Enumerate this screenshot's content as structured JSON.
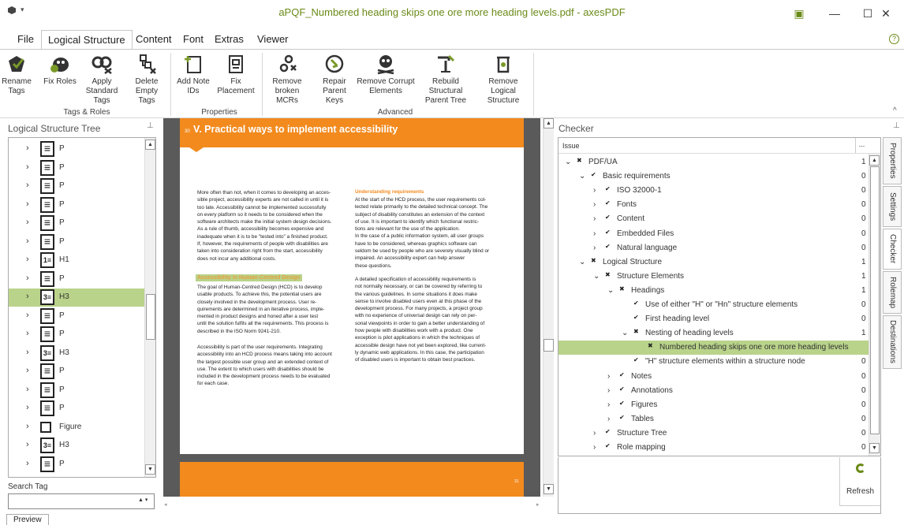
{
  "window": {
    "title": "aPQF_Numbered heading skips one ore more heading levels.pdf - axesPDF"
  },
  "menu": [
    "File",
    "Logical Structure",
    "Content",
    "Font",
    "Extras",
    "Viewer"
  ],
  "ribbon": {
    "buttons": [
      {
        "label1": "Rename",
        "label2": "Tags"
      },
      {
        "label1": "Fix Roles",
        "label2": ""
      },
      {
        "label1": "Apply",
        "label2": "Standard Tags"
      },
      {
        "label1": "Delete",
        "label2": "Empty Tags"
      },
      {
        "label1": "Add Note",
        "label2": "IDs"
      },
      {
        "label1": "Fix Placement",
        "label2": ""
      },
      {
        "label1": "Remove",
        "label2": "broken MCRs"
      },
      {
        "label1": "Repair",
        "label2": "Parent Keys"
      },
      {
        "label1": "Remove Corrupt",
        "label2": "Elements"
      },
      {
        "label1": "Rebuild Structural",
        "label2": "Parent Tree"
      },
      {
        "label1": "Remove Logical",
        "label2": "Structure"
      }
    ],
    "groups": [
      "Tags & Roles",
      "Properties",
      "Advanced"
    ]
  },
  "left_panel": {
    "title": "Logical Structure Tree",
    "items": [
      {
        "tag": "P",
        "icon": "paragraph-icon"
      },
      {
        "tag": "P",
        "icon": "paragraph-icon"
      },
      {
        "tag": "P",
        "icon": "paragraph-icon"
      },
      {
        "tag": "P",
        "icon": "paragraph-icon"
      },
      {
        "tag": "P",
        "icon": "paragraph-icon"
      },
      {
        "tag": "P",
        "icon": "paragraph-icon"
      },
      {
        "tag": "H1",
        "icon": "heading1-icon"
      },
      {
        "tag": "P",
        "icon": "paragraph-icon"
      },
      {
        "tag": "H3",
        "icon": "heading3-icon"
      },
      {
        "tag": "P",
        "icon": "paragraph-icon"
      },
      {
        "tag": "P",
        "icon": "paragraph-icon"
      },
      {
        "tag": "H3",
        "icon": "heading3-icon"
      },
      {
        "tag": "P",
        "icon": "paragraph-icon"
      },
      {
        "tag": "P",
        "icon": "paragraph-icon"
      },
      {
        "tag": "P",
        "icon": "paragraph-icon"
      },
      {
        "tag": "Figure",
        "icon": "figure-icon"
      },
      {
        "tag": "H3",
        "icon": "heading3-icon"
      },
      {
        "tag": "P",
        "icon": "paragraph-icon"
      }
    ],
    "search_label": "Search Tag",
    "search_value": ""
  },
  "document": {
    "heading_num": "30",
    "heading": "V. Practical ways to implement accessibility",
    "page_number": "31",
    "col1_p1": [
      "More often than not, when it comes to developing an acces-",
      "sible project, accessibility experts are not called in until it is",
      "too late. Accessibility cannot be implemented successfully",
      "on every platform so it needs to be considered when the",
      "software architects make the initial system design decisions.",
      "As a rule of thumb, accessibility becomes expensive and",
      "inadequate when it is to be \"tested into\" a finished product.",
      "If, however, the requirements of people with disabilities are",
      "taken into consideration right from the start, accessibility",
      "does not incur any additional costs."
    ],
    "col1_heading": "Accessibility in Human-Centred Design",
    "col1_p2": [
      "The goal of Human-Centred Design (HCD) is to develop",
      "usable products. To achieve this, the potential users are",
      "closely involved in the development process. User re-",
      "quirements are determined in an iterative process, imple-",
      "mented in product designs and honed after a user test",
      "until the solution fulfils all the requirements. This process is",
      "described in the ISO Norm 9241-210."
    ],
    "col1_p3": [
      "Accessibility is part of the user requirements. Integrating",
      "accessibility into an HCD process means taking into account",
      "the largest possible user group and an extended context of",
      "use. The extent to which users with disabilities should be",
      "included in the development process needs to be evaluated",
      "for each case."
    ],
    "col2_heading": "Understanding requirements",
    "col2_p1": [
      "At the start of the HCD process, the user requirements col-",
      "lected relate primarily to the detailed technical concept. The",
      "subject of disability constitutes an extension of the context",
      "of use. It is important to identify which functional restric-",
      "tions are relevant for the use of the application.",
      "In the case of a public information system, all user groups",
      "have to be considered, whereas graphics software can",
      "seldom be used by people who are severely visually blind or",
      "impaired. An accessibility expert can help answer",
      "these questions."
    ],
    "col2_p2": [
      "A detailed specification of accessibility requirements is",
      "not normally necessary, or can be covered by referring to",
      "the various guidelines. In some situations it does make",
      "sense to involve disabled users even at this phase of the",
      "development process. For many projects, a project group",
      "with no experience of universal design can rely on per-",
      "sonal viewpoints in order to gain a better understanding of",
      "how people with disabilities work with a product. One",
      "exception is pilot applications in which the techniques of",
      "accessible design have not yet been explored, like current-",
      "ly dynamic web applications. In this case, the participation",
      "of disabled users is important to obtain best practices."
    ]
  },
  "checker": {
    "title": "Checker",
    "column_issue": "Issue",
    "column_more": "...",
    "rows": [
      {
        "level": 0,
        "expand": "down",
        "mark": "x",
        "label": "PDF/UA",
        "count": "1"
      },
      {
        "level": 1,
        "expand": "down",
        "mark": "check",
        "label": "Basic requirements",
        "count": "0"
      },
      {
        "level": 2,
        "expand": "right",
        "mark": "check",
        "label": "ISO 32000-1",
        "count": "0"
      },
      {
        "level": 2,
        "expand": "right",
        "mark": "check",
        "label": "Fonts",
        "count": "0"
      },
      {
        "level": 2,
        "expand": "right",
        "mark": "check",
        "label": "Content",
        "count": "0"
      },
      {
        "level": 2,
        "expand": "right",
        "mark": "check",
        "label": "Embedded Files",
        "count": "0"
      },
      {
        "level": 2,
        "expand": "right",
        "mark": "check",
        "label": "Natural language",
        "count": "0"
      },
      {
        "level": 1,
        "expand": "down",
        "mark": "x",
        "label": "Logical Structure",
        "count": "1"
      },
      {
        "level": 2,
        "expand": "down",
        "mark": "x",
        "label": "Structure Elements",
        "count": "1"
      },
      {
        "level": 3,
        "expand": "down",
        "mark": "x",
        "label": "Headings",
        "count": "1"
      },
      {
        "level": 4,
        "expand": "",
        "mark": "check",
        "label": "Use of either \"H\" or \"Hn\" structure elements",
        "count": "0"
      },
      {
        "level": 4,
        "expand": "",
        "mark": "check",
        "label": "First heading level",
        "count": "0"
      },
      {
        "level": 4,
        "expand": "down",
        "mark": "x",
        "label": "Nesting of heading levels",
        "count": "1"
      },
      {
        "level": 5,
        "expand": "",
        "mark": "x",
        "label": "Numbered heading skips one ore more heading levels",
        "count": ""
      },
      {
        "level": 4,
        "expand": "",
        "mark": "check",
        "label": "\"H\" structure elements within a structure node",
        "count": "0"
      },
      {
        "level": 3,
        "expand": "right",
        "mark": "check",
        "label": "Notes",
        "count": "0"
      },
      {
        "level": 3,
        "expand": "right",
        "mark": "check",
        "label": "Annotations",
        "count": "0"
      },
      {
        "level": 3,
        "expand": "right",
        "mark": "check",
        "label": "Figures",
        "count": "0"
      },
      {
        "level": 3,
        "expand": "right",
        "mark": "check",
        "label": "Tables",
        "count": "0"
      },
      {
        "level": 2,
        "expand": "right",
        "mark": "check",
        "label": "Structure Tree",
        "count": "0"
      },
      {
        "level": 2,
        "expand": "right",
        "mark": "check",
        "label": "Role mapping",
        "count": "0"
      }
    ],
    "selected_index": 13,
    "refresh_label": "Refresh"
  },
  "side_tabs": [
    "Properties",
    "Settings",
    "Checker",
    "Rolemap",
    "Destinations"
  ],
  "bottom_tab": "Preview",
  "colors": {
    "accent": "#6a8a18",
    "selection": "#b9d38a",
    "orange": "#f28a1e"
  }
}
